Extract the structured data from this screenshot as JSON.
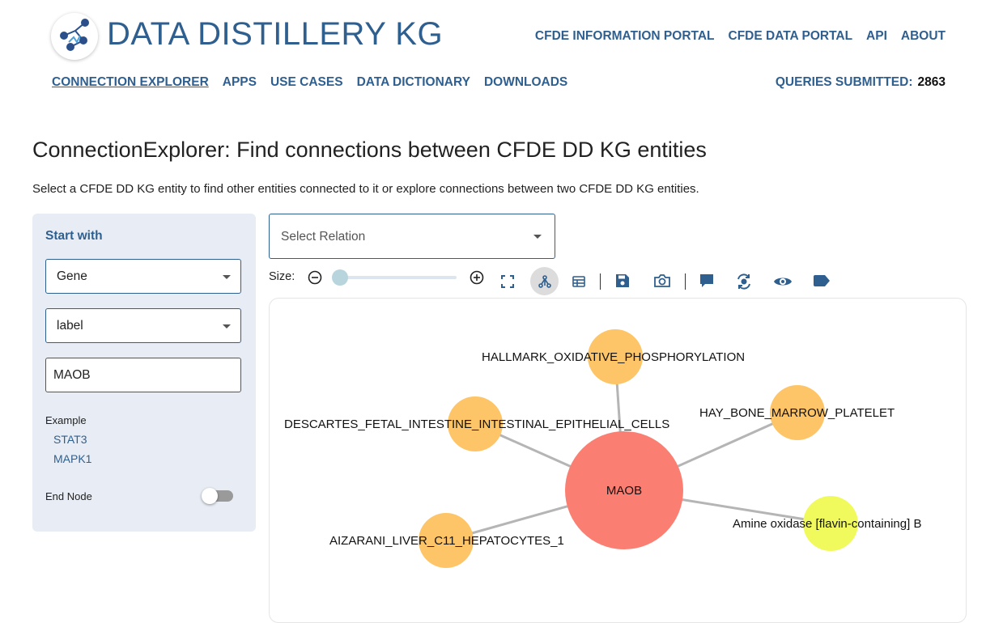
{
  "header": {
    "brand": "DATA DISTILLERY KG",
    "top_links": [
      "CFDE INFORMATION PORTAL",
      "CFDE DATA PORTAL",
      "API",
      "ABOUT"
    ],
    "nav": [
      "CONNECTION EXPLORER",
      "APPS",
      "USE CASES",
      "DATA DICTIONARY",
      "DOWNLOADS"
    ],
    "queries_label": "QUERIES SUBMITTED:",
    "queries_count": "2863"
  },
  "page": {
    "title": "ConnectionExplorer: Find connections between CFDE DD KG entities",
    "subtitle": "Select a CFDE DD KG entity to find other entities connected to it or explore connections between two CFDE DD KG entities."
  },
  "sidebar": {
    "title": "Start with",
    "entity_type": "Gene",
    "attribute": "label",
    "search_value": "MAOB",
    "example_label": "Example",
    "examples": [
      "STAT3",
      "MAPK1"
    ],
    "end_node_label": "End Node",
    "end_node_on": false
  },
  "relation": {
    "placeholder": "Select Relation"
  },
  "toolbar": {
    "size_label": "Size:",
    "size_value": 0,
    "icons": [
      "zoom-out-icon",
      "zoom-in-icon",
      "fullscreen-icon",
      "network-layout-icon",
      "table-icon",
      "save-icon",
      "camera-icon",
      "comment-icon",
      "refresh-icon",
      "eye-icon",
      "tag-icon"
    ]
  },
  "graph": {
    "nodes": [
      {
        "id": "MAOB",
        "label": "MAOB",
        "color": "#fa7f72"
      },
      {
        "id": "hallmark",
        "label": "HALLMARK_OXIDATIVE_PHOSPHORYLATION",
        "color": "#fdc567"
      },
      {
        "id": "descartes",
        "label": "DESCARTES_FETAL_INTESTINE_INTESTINAL_EPITHELIAL_CELLS",
        "color": "#fdc567"
      },
      {
        "id": "hay",
        "label": "HAY_BONE_MARROW_PLATELET",
        "color": "#fdc567"
      },
      {
        "id": "aizarani",
        "label": "AIZARANI_LIVER_C11_HEPATOCYTES_1",
        "color": "#fdc567"
      },
      {
        "id": "amine",
        "label": "Amine oxidase [flavin-containing] B",
        "color": "#f1fa5c"
      }
    ],
    "edges": [
      [
        "MAOB",
        "hallmark"
      ],
      [
        "MAOB",
        "descartes"
      ],
      [
        "MAOB",
        "hay"
      ],
      [
        "MAOB",
        "aizarani"
      ],
      [
        "MAOB",
        "amine"
      ]
    ]
  }
}
